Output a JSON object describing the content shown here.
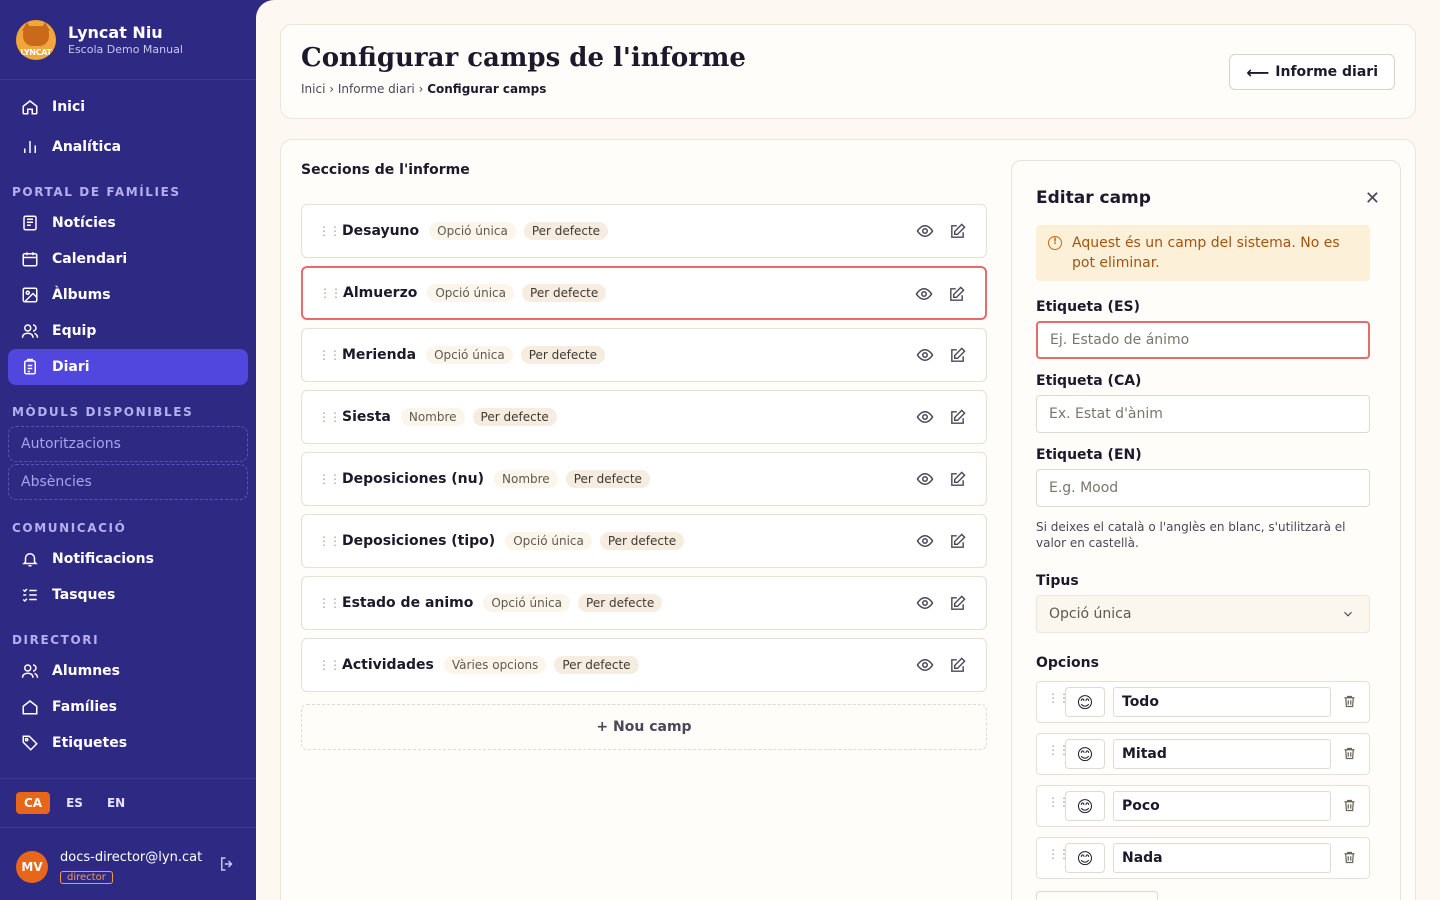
{
  "app": {
    "title": "Lyncat Niu",
    "subtitle": "Escola Demo Manual",
    "logo_text": "LYNCAT"
  },
  "nav": {
    "top": [
      {
        "label": "Inici"
      },
      {
        "label": "Analítica"
      }
    ],
    "portal_title": "PORTAL DE FAMÍLIES",
    "portal": [
      {
        "label": "Notícies"
      },
      {
        "label": "Calendari"
      },
      {
        "label": "Àlbums"
      },
      {
        "label": "Equip"
      },
      {
        "label": "Diari"
      }
    ],
    "modules_title": "MÒDULS DISPONIBLES",
    "modules": [
      {
        "label": "Autoritzacions"
      },
      {
        "label": "Absències"
      }
    ],
    "comm_title": "COMUNICACIÓ",
    "comm": [
      {
        "label": "Notificacions"
      },
      {
        "label": "Tasques"
      }
    ],
    "dir_title": "DIRECTORI",
    "dir": [
      {
        "label": "Alumnes"
      },
      {
        "label": "Famílies"
      },
      {
        "label": "Etiquetes"
      }
    ]
  },
  "languages": [
    "CA",
    "ES",
    "EN"
  ],
  "user": {
    "initials": "MV",
    "email": "docs-director@lyn.cat",
    "role": "director"
  },
  "header": {
    "title": "Configurar camps de l'informe",
    "breadcrumb": [
      "Inici",
      "Informe diari",
      "Configurar camps"
    ],
    "back_label": "Informe diari"
  },
  "sections": {
    "title": "Seccions de l'informe",
    "fields": [
      {
        "name": "Desayuno",
        "type": "Opció única",
        "default": "Per defecte"
      },
      {
        "name": "Almuerzo",
        "type": "Opció única",
        "default": "Per defecte"
      },
      {
        "name": "Merienda",
        "type": "Opció única",
        "default": "Per defecte"
      },
      {
        "name": "Siesta",
        "type": "Nombre",
        "default": "Per defecte"
      },
      {
        "name": "Deposiciones (nu)",
        "type": "Nombre",
        "default": "Per defecte"
      },
      {
        "name": "Deposiciones (tipo)",
        "type": "Opció única",
        "default": "Per defecte"
      },
      {
        "name": "Estado de animo",
        "type": "Opció única",
        "default": "Per defecte"
      },
      {
        "name": "Actividades",
        "type": "Vàries opcions",
        "default": "Per defecte"
      }
    ],
    "new_field": "+  Nou camp"
  },
  "edit": {
    "title": "Editar camp",
    "warning": "Aquest és un camp del sistema. No es pot eliminar.",
    "label_es": "Etiqueta (ES)",
    "placeholder_es": "Ej. Estado de ánimo",
    "label_ca": "Etiqueta (CA)",
    "placeholder_ca": "Ex. Estat d'ànim",
    "label_en": "Etiqueta (EN)",
    "placeholder_en": "E.g. Mood",
    "hint": "Si deixes el català o l'anglès en blanc, s'utilitzarà el valor en castellà.",
    "type_label": "Tipus",
    "type_value": "Opció única",
    "options_label": "Opcions",
    "options": [
      {
        "emoji": "😊",
        "value": "Todo"
      },
      {
        "emoji": "😊",
        "value": "Mitad"
      },
      {
        "emoji": "😊",
        "value": "Poco"
      },
      {
        "emoji": "😊",
        "value": "Nada"
      }
    ]
  },
  "colors": {
    "sidebar": "#2e2a83",
    "active_nav": "#5146dd",
    "accent_orange": "#e8661a",
    "error_border": "#e86b6b"
  }
}
